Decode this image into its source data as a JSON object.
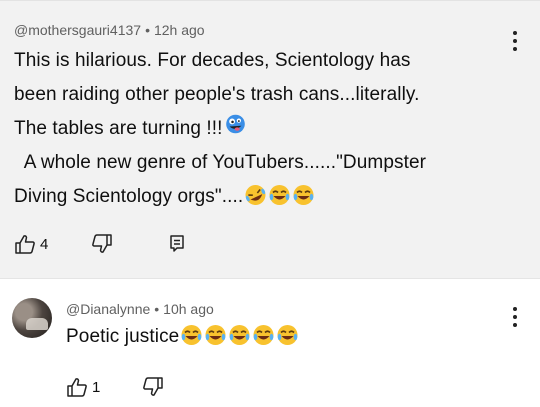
{
  "comments": [
    {
      "author": "@mothersgauri4137",
      "separator": "•",
      "time": "12h ago",
      "lines": [
        "This is hilarious.  For decades, Scientology has",
        "been raiding other people's trash cans...literally.",
        "The tables are turning !!!",
        "  A whole new genre of YouTubers......\"Dumpster",
        "Diving Scientology orgs\"...."
      ],
      "line_emojis": [
        [
          "zany-face"
        ],
        [],
        [],
        [],
        [
          "rofl",
          "joy",
          "joy"
        ]
      ],
      "likes": "4",
      "icons": [
        "like-icon",
        "dislike-icon",
        "reply-icon",
        "more-vertical-icon"
      ]
    },
    {
      "author": "@Dianalynne",
      "separator": "•",
      "time": "10h ago",
      "text": "Poetic justice",
      "emojis": [
        "joy",
        "joy",
        "joy",
        "joy",
        "joy"
      ],
      "likes": "1",
      "icons": [
        "avatar",
        "like-icon",
        "dislike-icon",
        "more-vertical-icon"
      ]
    }
  ],
  "colors": {
    "background_top": "#f2f2f2",
    "meta_text": "#606060",
    "body_text": "#0f0f0f",
    "emoji_face": "#f8c22e"
  }
}
